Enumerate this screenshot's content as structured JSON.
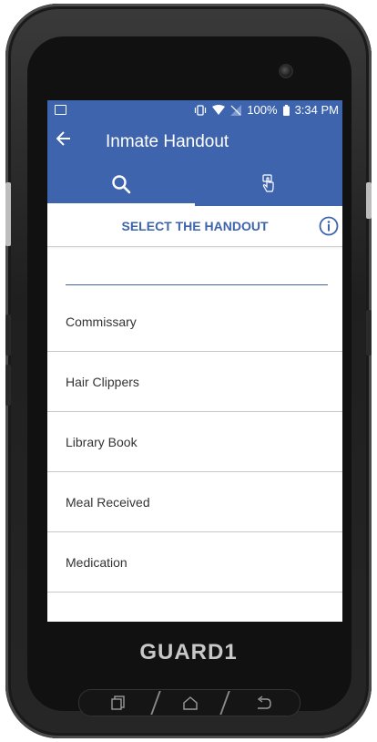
{
  "status_bar": {
    "battery": "100%",
    "time": "3:34 PM"
  },
  "app_bar": {
    "title": "Inmate Handout",
    "back_icon": "back-arrow-icon"
  },
  "tabs": [
    {
      "icon": "search-icon",
      "selected": true
    },
    {
      "icon": "tap-hand-icon",
      "selected": false
    }
  ],
  "section": {
    "title": "SELECT THE HANDOUT",
    "info_icon": "info-icon"
  },
  "handouts": [
    "Commissary",
    "Hair Clippers",
    "Library Book",
    "Meal Received",
    "Medication",
    ""
  ],
  "device": {
    "brand": "GUARD1"
  },
  "colors": {
    "accent": "#3e64ad",
    "text": "#333333",
    "divider": "#c8c8c8"
  }
}
